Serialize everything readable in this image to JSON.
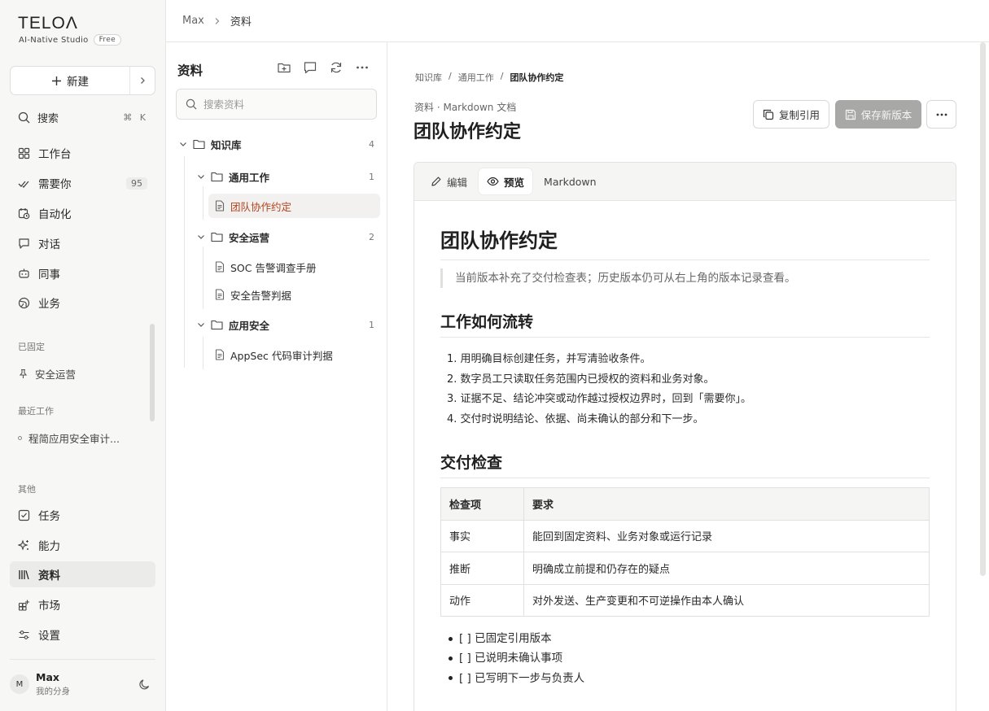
{
  "app": {
    "logo": "TELOΛ",
    "tagline": "AI-Native Studio",
    "plan_badge": "Free"
  },
  "sidebar": {
    "new_label": "新建",
    "search_label": "搜索",
    "search_shortcut": "⌘ K",
    "nav": [
      {
        "label": "工作台",
        "icon": "grid-icon"
      },
      {
        "label": "需要你",
        "icon": "double-check-icon",
        "count": "95"
      },
      {
        "label": "自动化",
        "icon": "calendar-clock-icon"
      },
      {
        "label": "对话",
        "icon": "chat-icon"
      },
      {
        "label": "同事",
        "icon": "bot-icon"
      },
      {
        "label": "业务",
        "icon": "globe-icon"
      }
    ],
    "pinned_label": "已固定",
    "pinned_items": [
      {
        "label": "安全运营",
        "icon": "pin-icon"
      }
    ],
    "recent_label": "最近工作",
    "recent_items": [
      {
        "label": "程简应用安全审计..."
      }
    ],
    "other_label": "其他",
    "other_nav": [
      {
        "label": "任务",
        "icon": "checkbox-icon"
      },
      {
        "label": "能力",
        "icon": "sparkle-icon"
      },
      {
        "label": "资料",
        "icon": "library-icon",
        "active": true
      },
      {
        "label": "市场",
        "icon": "apps-add-icon"
      },
      {
        "label": "设置",
        "icon": "sliders-icon"
      }
    ],
    "user": {
      "initial": "M",
      "name": "Max",
      "subtitle": "我的分身"
    }
  },
  "topbar": {
    "crumb_user": "Max",
    "crumb_current": "资料"
  },
  "tree": {
    "title": "资料",
    "search_placeholder": "搜索资料",
    "root": {
      "label": "知识库",
      "count": "4"
    },
    "folders": [
      {
        "label": "通用工作",
        "count": "1",
        "files": [
          "团队协作约定"
        ]
      },
      {
        "label": "安全运营",
        "count": "2",
        "files": [
          "SOC 告警调查手册",
          "安全告警判据"
        ]
      },
      {
        "label": "应用安全",
        "count": "1",
        "files": [
          "AppSec 代码审计判据"
        ]
      }
    ]
  },
  "doc": {
    "crumbs": [
      "知识库",
      "通用工作",
      "团队协作约定"
    ],
    "type": "资料 · Markdown 文档",
    "title": "团队协作约定",
    "copy_label": "复制引用",
    "save_label": "保存新版本",
    "tabs": [
      "编辑",
      "预览",
      "Markdown"
    ],
    "active_tab": "预览",
    "content": {
      "h1": "团队协作约定",
      "quote": "当前版本补充了交付检查表；历史版本仍可从右上角的版本记录查看。",
      "h2_flow": "工作如何流转",
      "steps": [
        "1. 用明确目标创建任务，并写清验收条件。",
        "2. 数字员工只读取任务范围内已授权的资料和业务对象。",
        "3. 证据不足、结论冲突或动作越过授权边界时，回到「需要你」。",
        "4. 交付时说明结论、依据、尚未确认的部分和下一步。"
      ],
      "h2_check": "交付检查",
      "table_headers": [
        "检查项",
        "要求"
      ],
      "table_rows": [
        [
          "事实",
          "能回到固定资料、业务对象或运行记录"
        ],
        [
          "推断",
          "明确成立前提和仍存在的疑点"
        ],
        [
          "动作",
          "对外发送、生产变更和不可逆操作由本人确认"
        ]
      ],
      "checklist": [
        "[ ] 已固定引用版本",
        "[ ] 已说明未确认事项",
        "[ ] 已写明下一步与负责人"
      ]
    }
  },
  "colors": {
    "accent": "#b2431f",
    "active_bg": "#ebebe9",
    "save_button": "#a8a8a6"
  }
}
